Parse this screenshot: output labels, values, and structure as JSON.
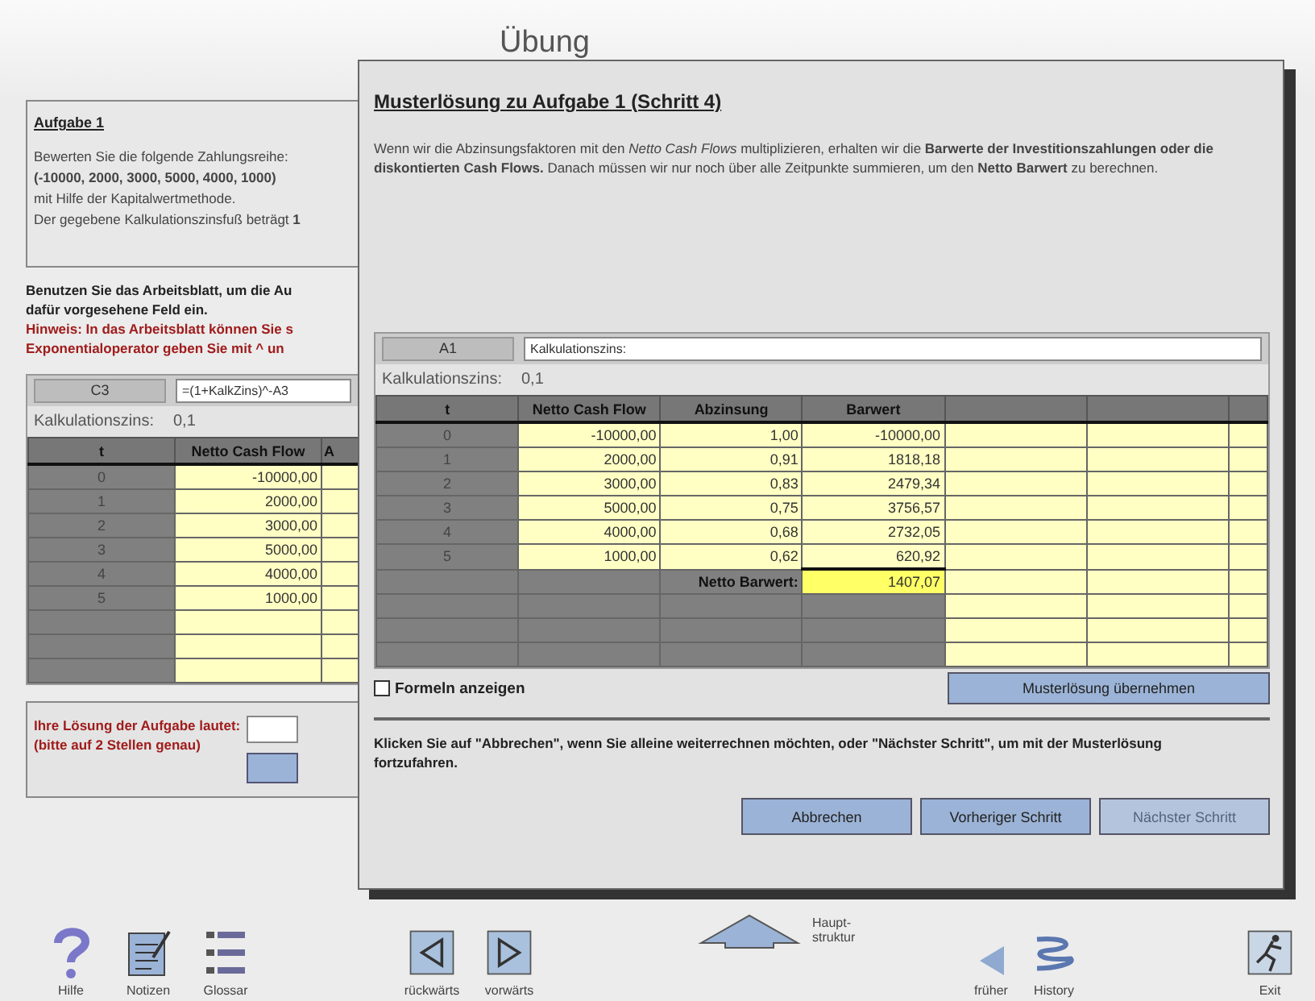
{
  "page_title": "Übung",
  "task": {
    "heading": "Aufgabe 1",
    "lines": [
      "Bewerten Sie die folgende Zahlungsreihe:",
      "**(-10000, 2000, 3000, 5000, 4000, 1000)**",
      "mit Hilfe der Kapitalwertmethode.",
      "Der gegebene Kalkulationszinsfuß beträgt **1**"
    ]
  },
  "instructions": [
    "Benutzen Sie das Arbeitsblatt, um die Au",
    "dafür vorgesehene Feld ein."
  ],
  "hints": [
    "Hinweis: In das Arbeitsblatt können Sie s",
    "Exponentialoperator geben Sie mit ^ un"
  ],
  "worksheet": {
    "cell_ref": "C3",
    "formula": "=(1+KalkZins)^-A3",
    "rate_label": "Kalkulationszins:",
    "rate_value": "0,1",
    "columns": [
      "t",
      "Netto Cash Flow",
      "A"
    ],
    "rows": [
      {
        "kind": "data",
        "cells": [
          "0",
          "-10000,00"
        ]
      },
      {
        "kind": "data",
        "cells": [
          "1",
          "2000,00"
        ]
      },
      {
        "kind": "data",
        "cells": [
          "2",
          "3000,00"
        ]
      },
      {
        "kind": "data",
        "cells": [
          "3",
          "5000,00"
        ]
      },
      {
        "kind": "data",
        "cells": [
          "4",
          "4000,00"
        ]
      },
      {
        "kind": "data",
        "cells": [
          "5",
          "1000,00"
        ]
      },
      {
        "kind": "blank"
      },
      {
        "kind": "blank"
      },
      {
        "kind": "blank"
      }
    ]
  },
  "answer": {
    "label": "Ihre Lösung der Aufgabe lautet:",
    "note": "(bitte auf 2 Stellen genau)"
  },
  "dialog": {
    "title": "Musterlösung zu Aufgabe 1 (Schritt 4)",
    "text": "Wenn wir die Abzinsungsfaktoren mit den *Netto Cash Flows* multiplizieren, erhalten wir die **Barwerte der Investitionszahlungen oder die diskontierten Cash Flows.** Danach müssen wir nur noch über alle Zeitpunkte summieren, um den **Netto Barwert** zu berechnen.",
    "cell_ref": "A1",
    "formula": "Kalkulationszins:",
    "rate_label": "Kalkulationszins:",
    "rate_value": "0,1",
    "columns": [
      "t",
      "Netto Cash Flow",
      "Abzinsung",
      "Barwert"
    ],
    "rows": [
      {
        "kind": "data",
        "cells": [
          "0",
          "-10000,00",
          "1,00",
          "-10000,00"
        ]
      },
      {
        "kind": "data",
        "cells": [
          "1",
          "2000,00",
          "0,91",
          "1818,18"
        ]
      },
      {
        "kind": "data",
        "cells": [
          "2",
          "3000,00",
          "0,83",
          "2479,34"
        ]
      },
      {
        "kind": "data",
        "cells": [
          "3",
          "5000,00",
          "0,75",
          "3756,57"
        ]
      },
      {
        "kind": "data",
        "cells": [
          "4",
          "4000,00",
          "0,68",
          "2732,05"
        ]
      },
      {
        "kind": "data",
        "cells": [
          "5",
          "1000,00",
          "0,62",
          "620,92"
        ]
      },
      {
        "kind": "total",
        "label": "Netto Barwert:",
        "value": "1407,07",
        "selected": true
      },
      {
        "kind": "blank"
      },
      {
        "kind": "blank"
      },
      {
        "kind": "blank"
      }
    ],
    "show_formulas": {
      "label": "Formeln anzeigen",
      "checked": false
    },
    "adopt_button": "Musterlösung übernehmen",
    "footer_text": "Klicken Sie auf \"Abbrechen\", wenn Sie alleine weiterrechnen möchten, oder \"Nächster Schritt\", um mit der Musterlösung fortzufahren.",
    "buttons": [
      {
        "label": "Abbrechen",
        "disabled": false
      },
      {
        "label": "Vorheriger Schritt",
        "disabled": false
      },
      {
        "label": "Nächster Schritt",
        "disabled": true
      }
    ]
  },
  "toolbar": [
    {
      "kind": "help",
      "label": "Hilfe"
    },
    {
      "kind": "notes",
      "label": "Notizen"
    },
    {
      "kind": "glossary",
      "label": "Glossar"
    },
    {
      "kind": "back",
      "label": "rückwärts"
    },
    {
      "kind": "forward",
      "label": "vorwärts"
    },
    {
      "kind": "up",
      "label": "Haupt-struktur"
    },
    {
      "kind": "earlier",
      "label": "früher"
    },
    {
      "kind": "history",
      "label": "History"
    },
    {
      "kind": "exit",
      "label": "Exit"
    }
  ]
}
